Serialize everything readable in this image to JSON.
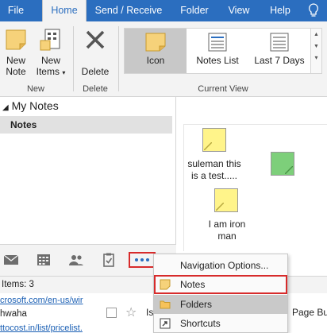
{
  "ribbon_tabs": [
    "File",
    "Home",
    "Send / Receive",
    "Folder",
    "View",
    "Help"
  ],
  "ribbon": {
    "new_note_label_1": "New",
    "new_note_label_2": "Note",
    "new_items_label_1": "New",
    "new_items_label_2": "Items",
    "delete_label": "Delete",
    "group_new": "New",
    "group_delete": "Delete",
    "group_current_view": "Current View",
    "view_icon": "Icon",
    "view_notes_list": "Notes List",
    "view_last7": "Last 7 Days"
  },
  "folder_pane": {
    "header": "My Notes",
    "selected_folder": "Notes"
  },
  "notes": [
    {
      "line1": "suleman this",
      "line2": "is  a test.....",
      "color": "#fff48a"
    },
    {
      "line1": "",
      "line2": "",
      "color": "#7dcf7a"
    },
    {
      "line1": "I am iron",
      "line2": "man",
      "color": "#fff48a"
    }
  ],
  "status": {
    "items": "Items: 3"
  },
  "background_rows": {
    "link1": "crosoft.com/en-us/wir",
    "text1": "hwaha",
    "link2": "ttocost.in/list/pricelist.",
    "partial_is": "Is",
    "partial_page": "Page Bu"
  },
  "context_menu": {
    "nav_options": "Navigation Options...",
    "notes": "Notes",
    "folders": "Folders",
    "shortcuts": "Shortcuts"
  },
  "colors": {
    "accent": "#2b6ebf",
    "highlight_box": "#d72b2b",
    "sticky_yellow": "#fff48a",
    "sticky_green": "#7dcf7a"
  }
}
